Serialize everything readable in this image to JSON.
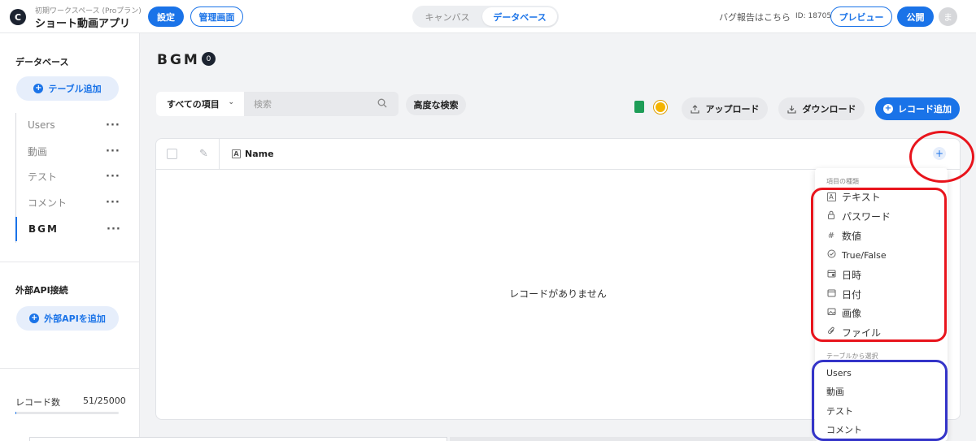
{
  "header": {
    "workspace": "初期ワークスペース (Proプラン)",
    "app_name": "ショート動画アプリ",
    "settings_label": "設定",
    "admin_label": "管理画面",
    "tabs": [
      {
        "label": "キャンバス"
      },
      {
        "label": "データベース"
      }
    ],
    "active_tab": "データベース",
    "bug_report": "バグ報告はこちら",
    "project_id": "ID: 18705",
    "preview_label": "プレビュー",
    "publish_label": "公開",
    "avatar_letter": "ま",
    "logo_letter": "C"
  },
  "sidebar": {
    "db_heading": "データベース",
    "add_table": "テーブル追加",
    "tables": [
      {
        "label": "Users"
      },
      {
        "label": "動画"
      },
      {
        "label": "テスト"
      },
      {
        "label": "コメント"
      },
      {
        "label": "BGM"
      }
    ],
    "active_table": "BGM",
    "api_heading": "外部API接続",
    "add_api": "外部APIを追加",
    "record_label": "レコード数",
    "record_count": "51/25000",
    "record_fraction": 0.002
  },
  "main": {
    "title": "BGM",
    "title_count": "0",
    "filter_label": "すべての項目",
    "search_placeholder": "検索",
    "advanced_search": "高度な検索",
    "upload": "アップロード",
    "download": "ダウンロード",
    "add_record": "レコード追加",
    "column_name": "Name",
    "empty_message": "レコードがありません"
  },
  "dropdown": {
    "types_heading": "項目の種類",
    "types": [
      {
        "label": "テキスト",
        "icon": "text-icon"
      },
      {
        "label": "パスワード",
        "icon": "lock-icon"
      },
      {
        "label": "数値",
        "icon": "hash-icon"
      },
      {
        "label": "True/False",
        "icon": "check-circle-icon"
      },
      {
        "label": "日時",
        "icon": "datetime-icon"
      },
      {
        "label": "日付",
        "icon": "calendar-icon"
      },
      {
        "label": "画像",
        "icon": "image-icon"
      },
      {
        "label": "ファイル",
        "icon": "paperclip-icon"
      }
    ],
    "tables_heading": "テーブルから選択",
    "tables": [
      {
        "label": "Users"
      },
      {
        "label": "動画"
      },
      {
        "label": "テスト"
      },
      {
        "label": "コメント"
      }
    ]
  },
  "colors": {
    "accent": "#1a73e8",
    "annotation_red": "#e8141c",
    "annotation_blue": "#3434c8",
    "dark": "#1c2330"
  }
}
